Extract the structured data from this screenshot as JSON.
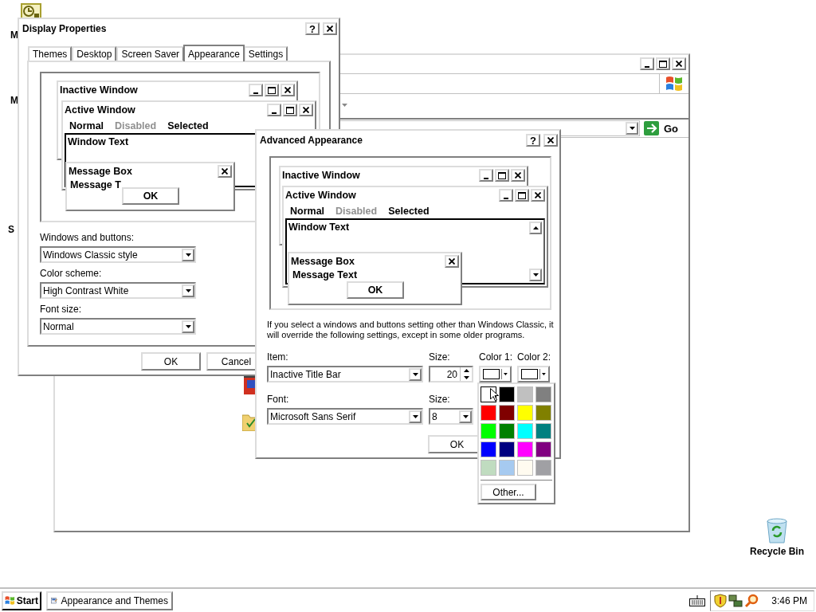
{
  "desktop_labels": [
    {
      "label": "M"
    },
    {
      "label": "M"
    },
    {
      "label": "S"
    }
  ],
  "recycle_bin": {
    "label": "Recycle Bin"
  },
  "explorer_window": {
    "go_button": "Go"
  },
  "display_properties": {
    "title": "Display Properties",
    "help_button": "?",
    "tabs": [
      {
        "label": "Themes",
        "selected": false
      },
      {
        "label": "Desktop",
        "selected": false
      },
      {
        "label": "Screen Saver",
        "selected": false
      },
      {
        "label": "Appearance",
        "selected": true
      },
      {
        "label": "Settings",
        "selected": false
      }
    ],
    "preview": {
      "inactive_title": "Inactive Window",
      "active_title": "Active Window",
      "menu": [
        {
          "label": "Normal",
          "disabled": false
        },
        {
          "label": "Disabled",
          "disabled": true
        },
        {
          "label": "Selected",
          "disabled": false
        }
      ],
      "window_text": "Window Text",
      "message_box_title": "Message Box",
      "message_text": "Message T",
      "ok_button": "OK"
    },
    "settings": [
      {
        "label": "Windows and buttons:",
        "value": "Windows Classic style"
      },
      {
        "label": "Color scheme:",
        "value": "High Contrast White"
      },
      {
        "label": "Font size:",
        "value": "Normal"
      }
    ],
    "buttons": [
      "OK",
      "Cancel"
    ]
  },
  "advanced_appearance": {
    "title": "Advanced Appearance",
    "help_button": "?",
    "preview": {
      "inactive_title": "Inactive Window",
      "active_title": "Active Window",
      "menu": [
        {
          "label": "Normal",
          "disabled": false
        },
        {
          "label": "Disabled",
          "disabled": true
        },
        {
          "label": "Selected",
          "disabled": false
        }
      ],
      "window_text": "Window Text",
      "message_box_title": "Message Box",
      "message_text": "Message Text",
      "ok_button": "OK"
    },
    "note": "If you select a windows and buttons setting other than Windows Classic, it will override the following settings, except in some older programs.",
    "item": {
      "label": "Item:",
      "value": "Inactive Title Bar"
    },
    "item_size": {
      "label": "Size:",
      "value": "20"
    },
    "color_1": {
      "label": "Color 1:",
      "color": "#ffffff"
    },
    "color_2": {
      "label": "Color 2:",
      "color": "#ffffff"
    },
    "font": {
      "label": "Font:",
      "value": "Microsoft Sans Serif"
    },
    "font_size": {
      "label": "Size:",
      "value": "8"
    },
    "ok_button": "OK"
  },
  "color_palette": {
    "swatches": [
      {
        "color": "#ffffff",
        "selected": true
      },
      {
        "color": "#000000",
        "selected": false
      },
      {
        "color": "#c0c0c0",
        "selected": false
      },
      {
        "color": "#808080",
        "selected": false
      },
      {
        "color": "#ff0000",
        "selected": false
      },
      {
        "color": "#800000",
        "selected": false
      },
      {
        "color": "#ffff00",
        "selected": false
      },
      {
        "color": "#808000",
        "selected": false
      },
      {
        "color": "#00ff00",
        "selected": false
      },
      {
        "color": "#008000",
        "selected": false
      },
      {
        "color": "#00ffff",
        "selected": false
      },
      {
        "color": "#008080",
        "selected": false
      },
      {
        "color": "#0000ff",
        "selected": false
      },
      {
        "color": "#000080",
        "selected": false
      },
      {
        "color": "#ff00ff",
        "selected": false
      },
      {
        "color": "#800080",
        "selected": false
      },
      {
        "color": "#c0dcc0",
        "selected": false
      },
      {
        "color": "#a6caf0",
        "selected": false
      },
      {
        "color": "#fffbf0",
        "selected": false
      },
      {
        "color": "#a0a0a4",
        "selected": false
      }
    ],
    "other_button": "Other..."
  },
  "taskbar": {
    "start_button": "Start",
    "tasks": [
      {
        "label": "Appearance and Themes",
        "selected": false
      }
    ],
    "clock": "3:46 PM"
  }
}
